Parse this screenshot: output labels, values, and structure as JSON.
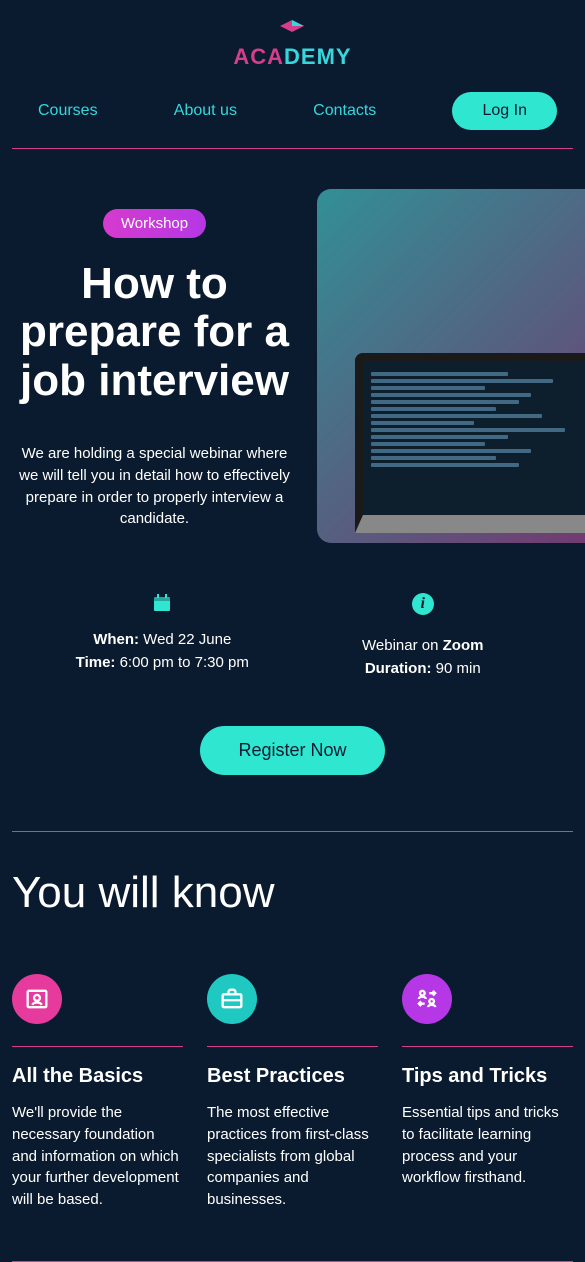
{
  "logo": {
    "part1": "ACA",
    "part2": "DEMY"
  },
  "nav": {
    "courses": "Courses",
    "about": "About us",
    "contacts": "Contacts",
    "login": "Log In"
  },
  "hero": {
    "badge": "Workshop",
    "title": "How to prepare for a job interview",
    "description": "We are holding a special webinar where we will tell you in detail how to effectively prepare in order to properly interview a candidate."
  },
  "info": {
    "when_label": "When:",
    "when_value": " Wed 22 June",
    "time_label": "Time:",
    "time_value": " 6:00 pm to 7:30 pm",
    "platform_prefix": "Webinar on ",
    "platform_value": "Zoom",
    "duration_label": "Duration:",
    "duration_value": " 90 min"
  },
  "register": "Register Now",
  "know": {
    "title": "You will know",
    "cols": [
      {
        "heading": "All the Basics",
        "text": "We'll provide the necessary foundation and information on which your further development will be based."
      },
      {
        "heading": "Best Practices",
        "text": "The most effective practices from first-class specialists from global companies and businesses."
      },
      {
        "heading": "Tips and Tricks",
        "text": "Essential tips and tricks to facilitate learning process and your workflow firsthand."
      }
    ]
  }
}
